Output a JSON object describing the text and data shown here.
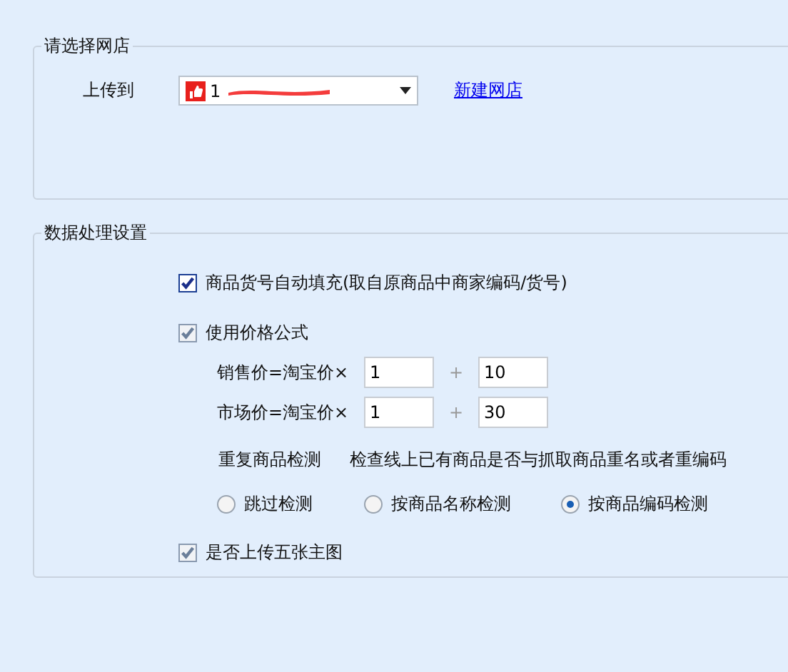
{
  "shop_group": {
    "legend": "请选择网店",
    "upload_label": "上传到",
    "shop_select": {
      "value": "1",
      "redacted": true
    },
    "new_shop_link": "新建网店"
  },
  "data_group": {
    "legend": "数据处理设置",
    "auto_fill": {
      "label": "商品货号自动填充(取自原商品中商家编码/货号)",
      "checked": true,
      "disabled": false
    },
    "price_formula": {
      "label": "使用价格公式",
      "checked": true,
      "disabled": true
    },
    "formulas": [
      {
        "label": "销售价=淘宝价×",
        "multiplier": "1",
        "plus": "+",
        "addend": "10"
      },
      {
        "label": "市场价=淘宝价×",
        "multiplier": "1",
        "plus": "+",
        "addend": "30"
      }
    ],
    "duplicate_check": {
      "label": "重复商品检测",
      "description": "检查线上已有商品是否与抓取商品重名或者重编码"
    },
    "duplicate_options": [
      {
        "label": "跳过检测",
        "selected": false
      },
      {
        "label": "按商品名称检测",
        "selected": false
      },
      {
        "label": "按商品编码检测",
        "selected": true
      }
    ],
    "upload_images": {
      "label": "是否上传五张主图",
      "checked": true,
      "disabled": true
    }
  }
}
